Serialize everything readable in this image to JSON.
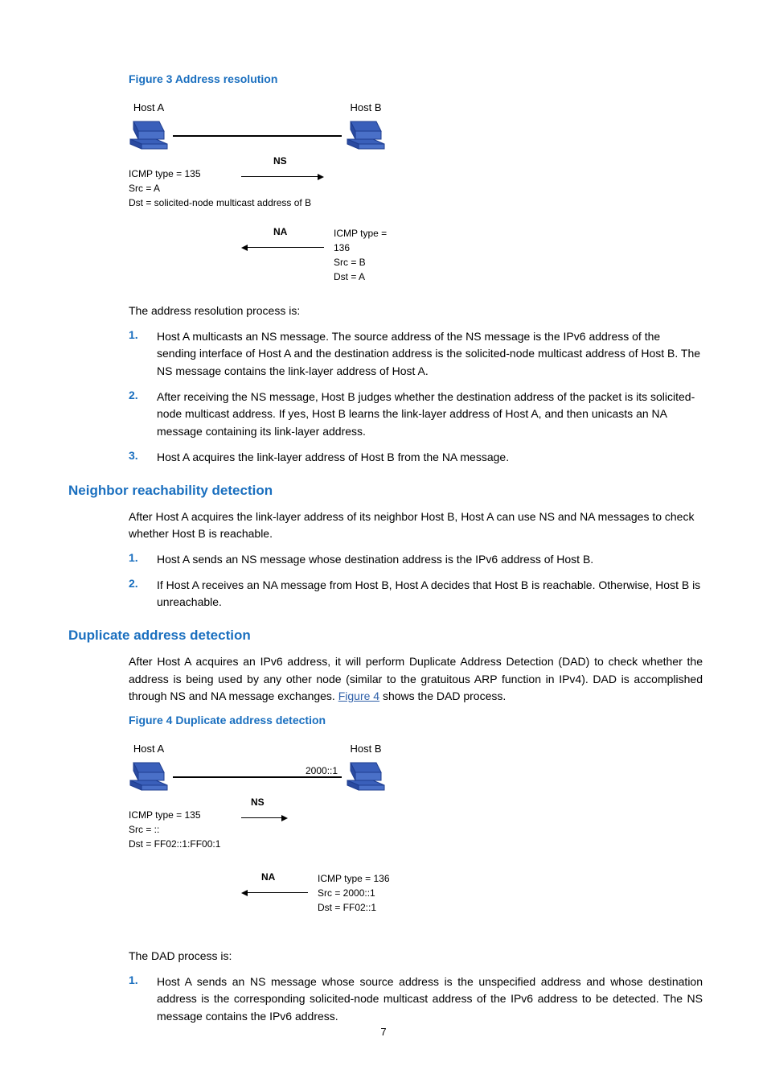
{
  "fig3": {
    "caption": "Figure 3 Address resolution",
    "hostA": "Host A",
    "hostB": "Host B",
    "ns_label": "NS",
    "na_label": "NA",
    "ns_icmp": "ICMP type = 135",
    "ns_src": "Src = A",
    "ns_dst": "Dst = solicited-node multicast address of B",
    "na_icmp": "ICMP type = 136",
    "na_src": "Src = B",
    "na_dst": "Dst = A"
  },
  "ar_intro": "The address resolution process is:",
  "ar_steps": {
    "n1": "1.",
    "t1": "Host A multicasts an NS message. The source address of the NS message is the IPv6 address of the sending interface of Host A and the destination address is the solicited-node multicast address of Host B. The NS message contains the link-layer address of Host A.",
    "n2": "2.",
    "t2": "After receiving the NS message, Host B judges whether the destination address of the packet is its solicited-node multicast address. If yes, Host B learns the link-layer address of Host A, and then unicasts an NA message containing its link-layer address.",
    "n3": "3.",
    "t3": "Host A acquires the link-layer address of Host B from the NA message."
  },
  "nrd": {
    "title": "Neighbor reachability detection",
    "intro": "After Host A acquires the link-layer address of its neighbor Host B, Host A can use NS and NA messages to check whether Host B is reachable.",
    "n1": "1.",
    "t1": "Host A sends an NS message whose destination address is the IPv6 address of Host B.",
    "n2": "2.",
    "t2": "If Host A receives an NA message from Host B, Host A decides that Host B is reachable. Otherwise, Host B is unreachable."
  },
  "dad": {
    "title": "Duplicate address detection",
    "intro_pre": "After Host A acquires an IPv6 address, it will perform Duplicate Address Detection (DAD) to check whether the address is being used by any other node (similar to the gratuitous ARP function in IPv4). DAD is accomplished through NS and NA message exchanges. ",
    "intro_link": "Figure 4",
    "intro_post": " shows the DAD process."
  },
  "fig4": {
    "caption": "Figure 4 Duplicate address detection",
    "hostA": "Host A",
    "hostB": "Host B",
    "ipB": "2000::1",
    "ns_label": "NS",
    "na_label": "NA",
    "ns_icmp": "ICMP type = 135",
    "ns_src": "Src = ::",
    "ns_dst": "Dst = FF02::1:FF00:1",
    "na_icmp": "ICMP type = 136",
    "na_src": "Src = 2000::1",
    "na_dst": "Dst = FF02::1"
  },
  "dad_intro2": "The DAD process is:",
  "dad_steps": {
    "n1": "1.",
    "t1": "Host A sends an NS message whose source address is the unspecified address and whose destination address is the corresponding solicited-node multicast address of the IPv6 address to be detected. The NS message contains the IPv6 address."
  },
  "page_number": "7"
}
